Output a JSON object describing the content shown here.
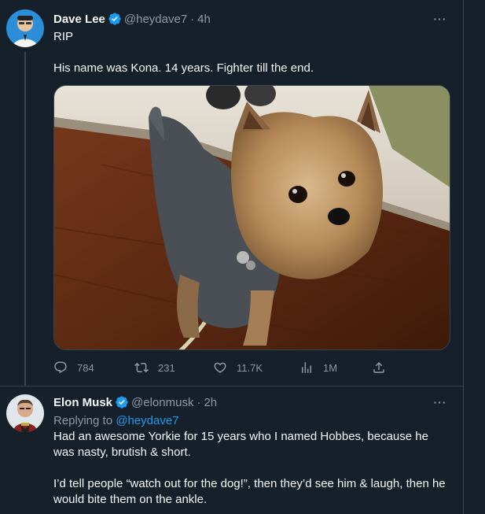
{
  "tweet1": {
    "author_name": "Dave Lee",
    "handle": "@heydave7",
    "separator": "·",
    "time": "4h",
    "text_line1": "RIP",
    "text_line2": "His name was Kona.  14 years.  Fighter till the end.",
    "media_alt": "Yorkshire terrier photo",
    "stats": {
      "replies": "784",
      "retweets": "231",
      "likes": "11.7K",
      "views": "1M"
    }
  },
  "tweet2": {
    "author_name": "Elon Musk",
    "handle": "@elonmusk",
    "separator": "·",
    "time": "2h",
    "replying_prefix": "Replying to ",
    "replying_handle": "@heydave7",
    "para1": "Had an awesome Yorkie for 15 years who I named Hobbes, because he was nasty, brutish & short.",
    "para2": "I’d tell people “watch out for the dog!”, then they’d see him & laugh, then he would bite them on the ankle."
  },
  "colors": {
    "background": "#15202b",
    "text": "#f7f9f9",
    "secondary": "#8b98a5",
    "accent": "#1d9bf0",
    "border": "#38444d"
  },
  "icons": [
    "verified-badge-icon",
    "more-icon",
    "reply-icon",
    "retweet-icon",
    "like-icon",
    "views-icon",
    "share-icon"
  ]
}
